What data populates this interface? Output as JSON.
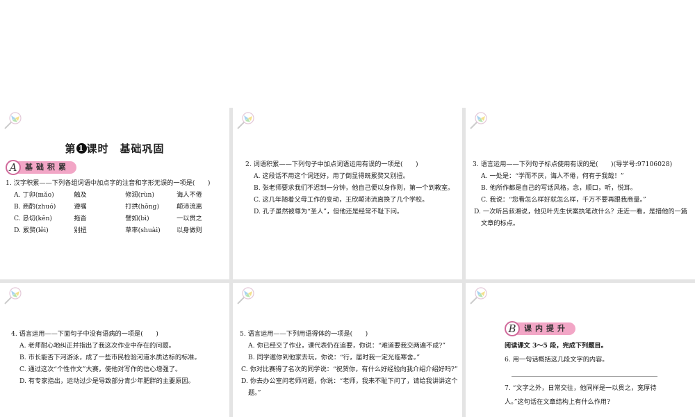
{
  "card1": {
    "title_prefix": "第",
    "title_num": "1",
    "title_suffix": "课时　基础巩固",
    "section_letter": "A",
    "section_label": "基础积累",
    "q1": {
      "stem": "1. 汉字积累——下列各组词语中加点字的注音和字形无误的一项是(　　)",
      "rows": [
        [
          "A. 丁卯(mǎo)",
          "触及",
          "修润(rùn)",
          "诲人不倦"
        ],
        [
          "B. 商酌(zhuó)",
          "遵嘱",
          "打拱(hǒng)",
          "颠沛流离"
        ],
        [
          "C. 恳切(kěn)",
          "拖沓",
          "譬如(bì)",
          "一以贯之"
        ],
        [
          "D. 累赘(lěi)",
          "别扭",
          "草率(shuài)",
          "以身做则"
        ]
      ]
    }
  },
  "card2": {
    "q2": {
      "stem": "2. 词语积累——下列句子中加点词语运用有误的一项是(　　)",
      "options": [
        "A. 这段话不用这个词还好，用了倒显得既累赘又别扭。",
        "B. 张老师要求我们不迟到一分钟，他自己便以身作则，第一个到教室。",
        "C. 这几年随着父母工作的变动，王欣颠沛流离换了几个学校。",
        "D. 孔子虽然被尊为“圣人”，但他还是经常不耻下问。"
      ]
    }
  },
  "card3": {
    "q3": {
      "stem": "3. 语言运用——下列句子标点使用有误的是(　　)(导学号:97106028)",
      "options": [
        "A. 一处是：“学而不厌，诲人不倦，何有于我哉！”",
        "B. 他所作都是自己的写话风格，念，顺口，听，悦耳。",
        "C. 我说：“您看怎么样好就怎么样，千万不要再跟我商量。”",
        "D. 一次听吕叔湘说，他见叶先生伏案执笔改什么？走近一看，是措他的一篇文章的标点。"
      ]
    }
  },
  "card4": {
    "q4": {
      "stem": "4. 语言运用——下面句子中没有语病的一项是(　　)",
      "options": [
        "A. 老师耐心地纠正并指出了我这次作业中存在的问题。",
        "B. 市长能否下河游泳，成了一些市民检验河道水质达标的标准。",
        "C. 通过这次“个性作文”大赛，使他对写作的信心增强了。",
        "D. 有专家指出，运动过少是导致部分青少年肥胖的主要原因。"
      ]
    }
  },
  "card5": {
    "q5": {
      "stem": "5. 语言运用——下列用语得体的一项是(　　)",
      "options": [
        "A. 你已经交了作业，课代表仍在追要，你说：“难道要我交两遍不成?”",
        "B. 同学邀你到他家去玩，你说：“行，届时我一定光临寒舍。”",
        "C. 你对比赛得了名次的同学说：“祝贺你，有什么好经验向我介绍介绍好吗?”",
        "D. 你去办公室问老师问题，你说：“老师，我来不耻下问了，请给我讲讲这个题。”"
      ]
    }
  },
  "card6": {
    "section_letter": "B",
    "section_label": "课内提升",
    "intro": "阅读课文 3～5 段，完成下列题目。",
    "q6": "6. 用一句话概括这几段文字的内容。",
    "q7": "7. “文字之外，日常交往，他同样是一以贯之，宽厚待人。”这句话在文章结构上有什么作用?"
  }
}
